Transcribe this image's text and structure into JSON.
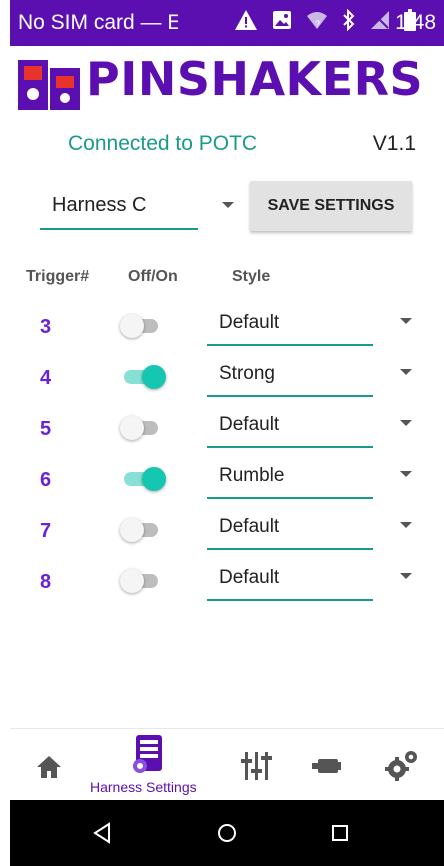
{
  "status_bar": {
    "carrier": "No SIM card — Emergency calls only",
    "time": "1:48"
  },
  "header": {
    "logo_text": "PINSHAKERS"
  },
  "connection": {
    "status": "Connected to POTC",
    "version": "V1.1"
  },
  "harness_select": {
    "value": "Harness C"
  },
  "save_button": {
    "label": "SAVE SETTINGS"
  },
  "table": {
    "headers": [
      "Trigger#",
      "Off/On",
      "Style"
    ],
    "rows": [
      {
        "trigger": "3",
        "on": false,
        "style": "Default"
      },
      {
        "trigger": "4",
        "on": true,
        "style": "Strong"
      },
      {
        "trigger": "5",
        "on": false,
        "style": "Default"
      },
      {
        "trigger": "6",
        "on": true,
        "style": "Rumble"
      },
      {
        "trigger": "7",
        "on": false,
        "style": "Default"
      },
      {
        "trigger": "8",
        "on": false,
        "style": "Default"
      }
    ]
  },
  "bottom_nav": {
    "items": [
      {
        "icon": "home-icon"
      },
      {
        "icon": "harness-settings-icon",
        "label": "Harness Settings",
        "active": true
      },
      {
        "icon": "sliders-icon"
      },
      {
        "icon": "plug-icon"
      },
      {
        "icon": "gears-icon"
      }
    ]
  },
  "colors": {
    "accent": "#5b0fb0",
    "teal": "#1a9a8a",
    "toggle_on": "#15c7b0"
  }
}
